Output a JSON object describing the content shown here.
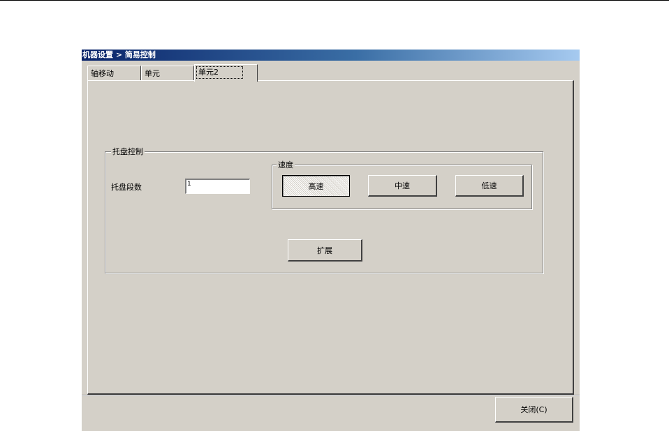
{
  "window": {
    "title": "机器设置 > 简易控制"
  },
  "tabs": [
    {
      "label": "轴移动"
    },
    {
      "label": "单元"
    },
    {
      "label": "单元2"
    }
  ],
  "tray_control": {
    "title": "托盘控制",
    "count_label": "托盘段数",
    "count_value": "1",
    "speed": {
      "title": "速度",
      "high": "高速",
      "mid": "中速",
      "low": "低速",
      "selected": "高速"
    },
    "expand_label": "扩展"
  },
  "footer": {
    "close_label": "关闭(C)"
  }
}
